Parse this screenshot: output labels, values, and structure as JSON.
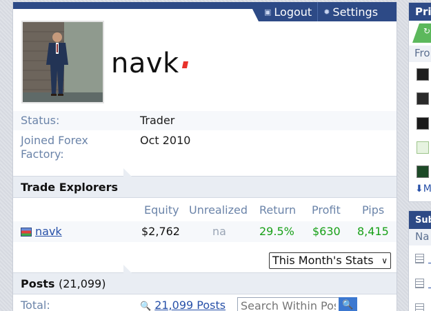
{
  "header": {
    "logout_label": "Logout",
    "settings_label": "Settings"
  },
  "profile": {
    "username": "navk",
    "status_key": "Status:",
    "status_value": "Trader",
    "joined_key": "Joined Forex Factory:",
    "joined_value": "Oct 2010"
  },
  "trade_explorers": {
    "title": "Trade Explorers",
    "columns": [
      "Equity",
      "Unrealized",
      "Return",
      "Profit",
      "Pips"
    ],
    "rows": [
      {
        "name": "navk",
        "equity": "$2,762",
        "unrealized": "na",
        "return": "29.5%",
        "profit": "$630",
        "pips": "8,415"
      }
    ],
    "stats_select": "This Month's Stats"
  },
  "posts": {
    "title": "Posts",
    "count": "(21,099)",
    "total_key": "Total:",
    "total_link": "21,099 Posts",
    "search_placeholder": "Search Within Posts"
  },
  "sidebar": {
    "panel1_title": "Pri",
    "panel1_sub": "Fro",
    "panel1_more": "M",
    "panel2_title": "Sub",
    "panel2_sub": "Na"
  },
  "colors": {
    "header_bg": "#2d4a86",
    "positive": "#18a018",
    "link": "#2750a8",
    "label": "#6b84a9"
  }
}
